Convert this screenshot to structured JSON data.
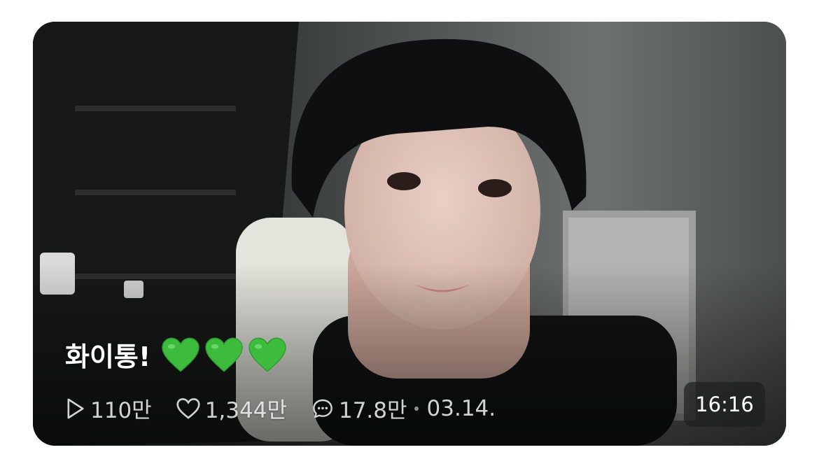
{
  "video": {
    "title": "화이통!",
    "title_emoji": [
      "green-heart",
      "green-heart",
      "green-heart"
    ],
    "views": "110만",
    "likes": "1,344만",
    "comments": "17.8만",
    "date": "03.14.",
    "duration": "16:16"
  },
  "icons": {
    "views": "play-outline-icon",
    "likes": "heart-outline-icon",
    "comments": "chat-bubble-icon"
  },
  "colors": {
    "heart": "#3dbb3d",
    "meta_text": "#d1d1d1"
  }
}
